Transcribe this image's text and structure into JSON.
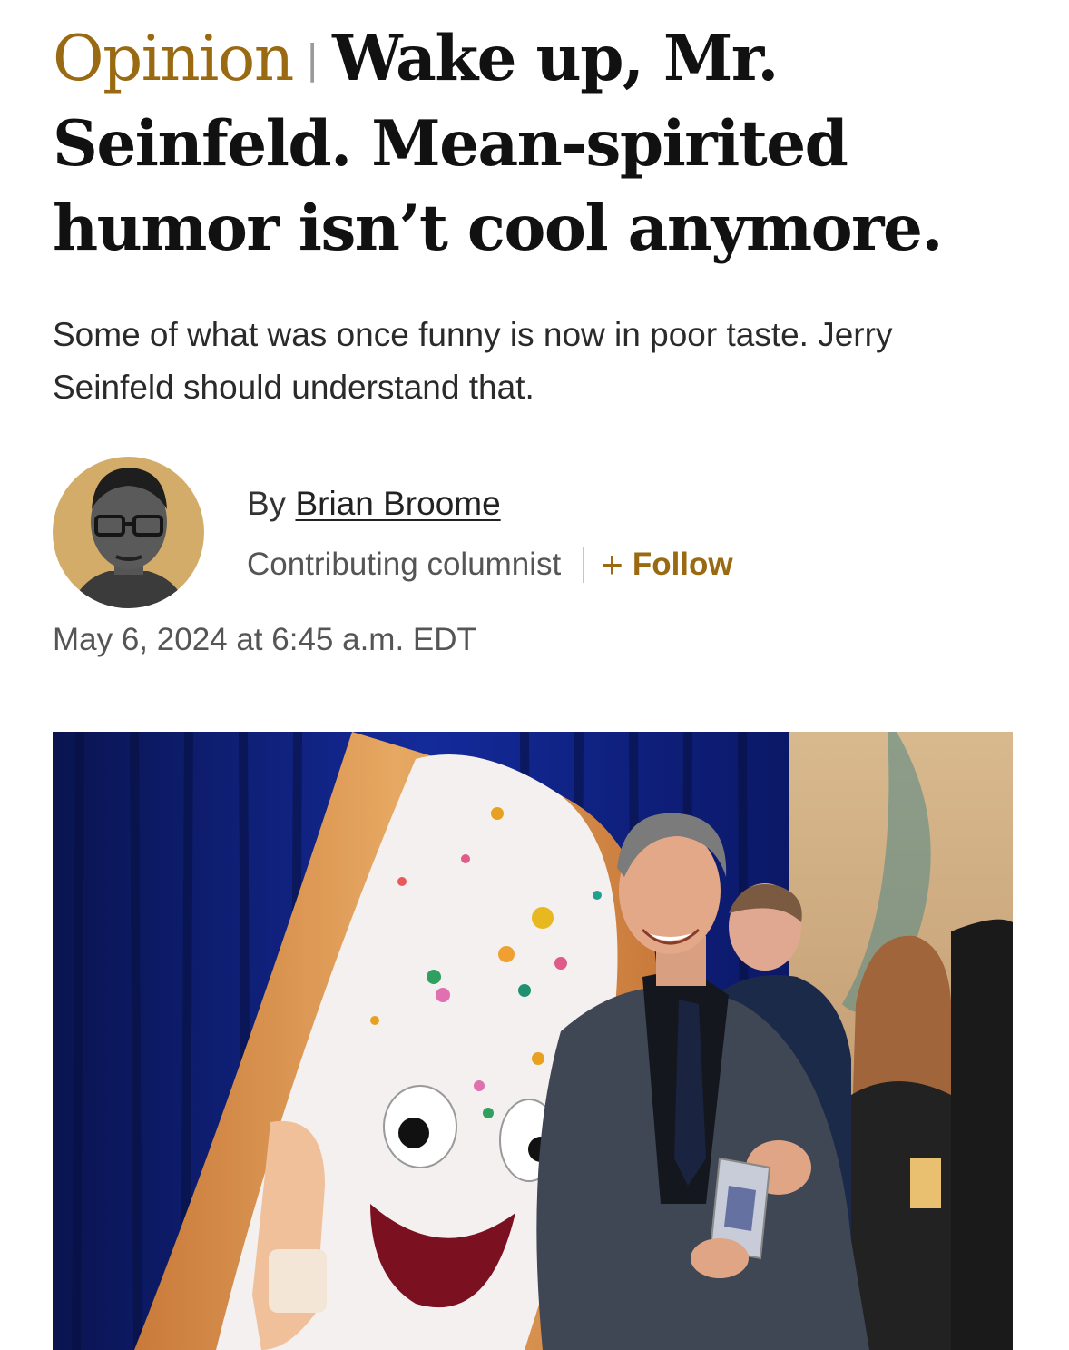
{
  "article": {
    "kicker": "Opinion",
    "kicker_separator": "|",
    "headline": "Wake up, Mr. Seinfeld. Mean-spirited humor isn’t cool anymore.",
    "subheadline": "Some of what was once funny is now in poor taste. Jerry Seinfeld should understand that.",
    "byline_prefix": "By",
    "author": "Brian Broome",
    "role": "Contributing columnist",
    "follow_label": "Follow",
    "follow_icon": "plus-icon",
    "timestamp": "May 6, 2024 at 6:45 a.m. EDT"
  },
  "colors": {
    "kicker": "#9a6a12",
    "follow": "#9a6a12",
    "avatar_background": "#d3ac6a",
    "curtain": "#0d1a6a"
  }
}
